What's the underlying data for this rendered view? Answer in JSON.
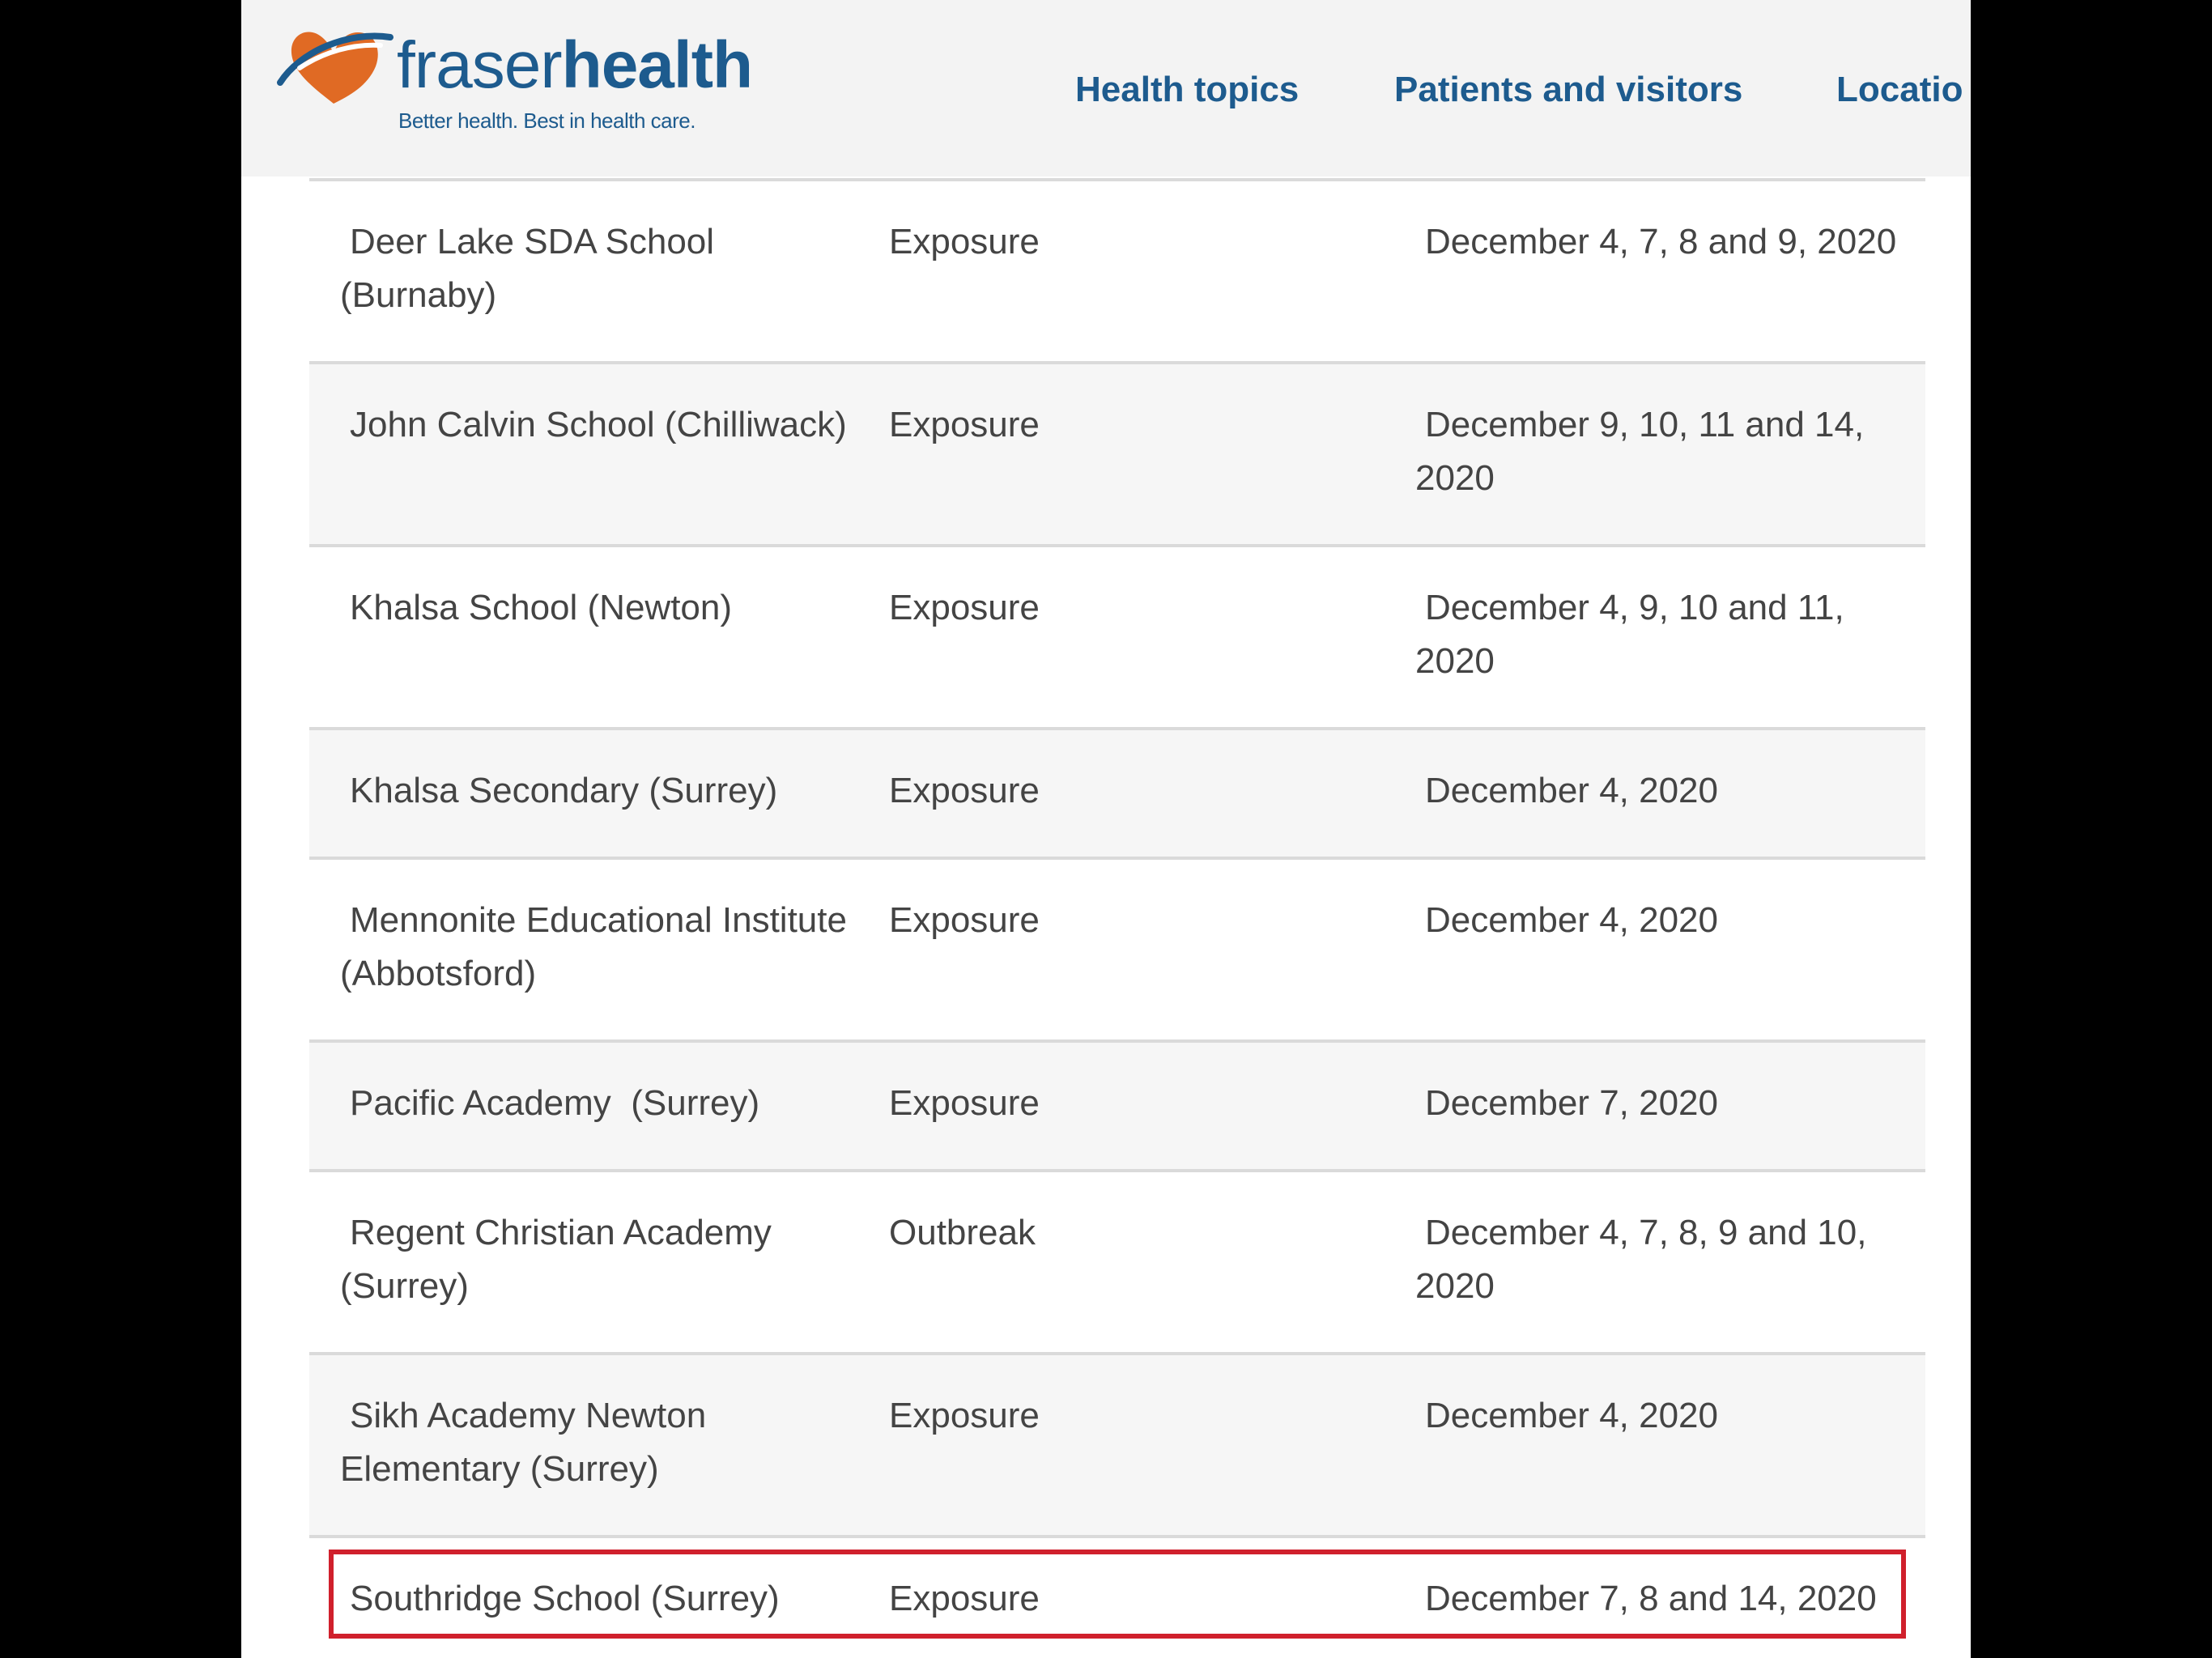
{
  "header": {
    "logo_word_light": "fraser",
    "logo_word_bold": "health",
    "logo_tagline": "Better health. Best in health care.",
    "nav": [
      "Health topics",
      "Patients and visitors",
      "Locatio"
    ]
  },
  "table": {
    "rows": [
      {
        "name": "Deer Lake SDA School (Burnaby)",
        "status": "Exposure",
        "dates": "December 4, 7, 8 and 9, 2020"
      },
      {
        "name": "John Calvin School (Chilliwack)",
        "status": "Exposure",
        "dates": "December 9, 10, 11 and 14, 2020"
      },
      {
        "name": "Khalsa School (Newton)",
        "status": "Exposure",
        "dates": "December 4, 9, 10 and 11, 2020"
      },
      {
        "name": "Khalsa Secondary (Surrey)",
        "status": "Exposure",
        "dates": "December 4, 2020"
      },
      {
        "name": "Mennonite Educational Institute (Abbotsford)",
        "status": "Exposure",
        "dates": "December 4, 2020"
      },
      {
        "name": "Pacific Academy  (Surrey)",
        "status": "Exposure",
        "dates": "December 7, 2020"
      },
      {
        "name": "Regent Christian Academy (Surrey)",
        "status": "Outbreak",
        "dates": "December 4, 7, 8, 9 and 10, 2020"
      },
      {
        "name": "Sikh Academy Newton Elementary (Surrey)",
        "status": "Exposure",
        "dates": "December 4, 2020"
      },
      {
        "name": "Southridge School (Surrey)",
        "status": "Exposure",
        "dates": "December 7, 8 and 14, 2020"
      }
    ]
  },
  "colors": {
    "brand_blue": "#1d5b8e",
    "logo_orange": "#e06a24",
    "highlight_red": "#d0202c"
  }
}
